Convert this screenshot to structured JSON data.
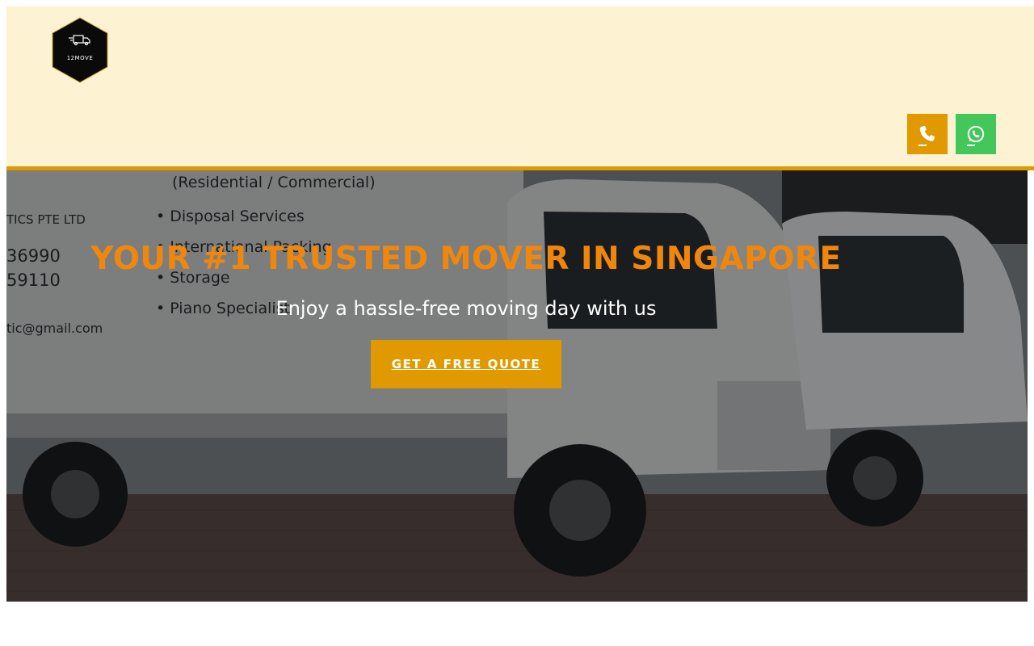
{
  "header": {
    "logo_text": "12MOVE",
    "logo_icon": "truck-icon",
    "phone_icon": "phone-icon",
    "whatsapp_icon": "whatsapp-icon"
  },
  "hero": {
    "title": "YOUR #1 TRUSTED MOVER IN SINGAPORE",
    "subtitle": "Enjoy a hassle-free moving day with us",
    "cta_label": "GET A FREE QUOTE",
    "truck_signage": {
      "line1": "(Residential / Commercial)",
      "line2": "TICS PTE LTD",
      "line3": "36990",
      "line4": "59110",
      "line5": "tic@gmail.com",
      "item1": "• Disposal Services",
      "item2": "• International Packing",
      "item3": "• Storage",
      "item4": "• Piano Specialist"
    }
  },
  "colors": {
    "accent": "#e09a00",
    "title_orange": "#f0870c",
    "header_bg": "#fdf2d1",
    "whatsapp_green": "#44c75a"
  }
}
